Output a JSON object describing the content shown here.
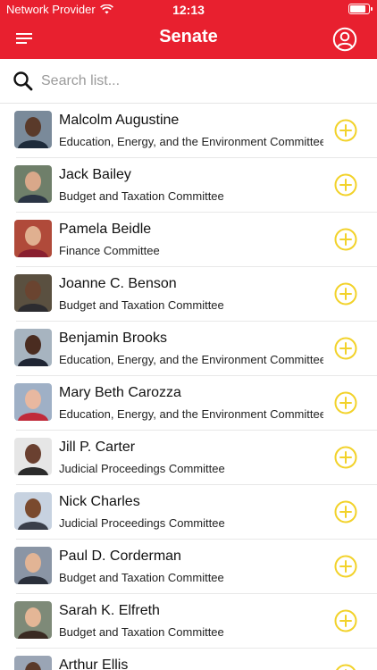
{
  "status_bar": {
    "carrier": "Network Provider",
    "time": "12:13"
  },
  "header": {
    "title": "Senate"
  },
  "search": {
    "placeholder": "Search list..."
  },
  "colors": {
    "header_bg": "#e8202f",
    "accent_yellow": "#f2d22a"
  },
  "icons": {
    "menu": "menu-icon",
    "profile": "account-icon",
    "search": "search-icon",
    "add": "add-circle-icon",
    "wifi": "wifi-icon",
    "battery": "battery-icon"
  },
  "members": [
    {
      "name": "Malcolm Augustine",
      "committee": "Education, Energy, and the Environment Committee"
    },
    {
      "name": "Jack Bailey",
      "committee": "Budget and Taxation Committee"
    },
    {
      "name": "Pamela Beidle",
      "committee": "Finance Committee"
    },
    {
      "name": "Joanne C. Benson",
      "committee": "Budget and Taxation Committee"
    },
    {
      "name": "Benjamin Brooks",
      "committee": "Education, Energy, and the Environment Committee"
    },
    {
      "name": "Mary Beth Carozza",
      "committee": "Education, Energy, and the Environment Committee"
    },
    {
      "name": "Jill P. Carter",
      "committee": "Judicial Proceedings Committee"
    },
    {
      "name": "Nick Charles",
      "committee": "Judicial Proceedings Committee"
    },
    {
      "name": "Paul D. Corderman",
      "committee": "Budget and Taxation Committee"
    },
    {
      "name": "Sarah K. Elfreth",
      "committee": "Budget and Taxation Committee"
    },
    {
      "name": "Arthur Ellis",
      "committee": ""
    }
  ]
}
